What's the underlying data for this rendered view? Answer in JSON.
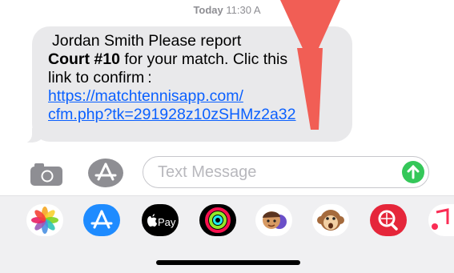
{
  "header": {
    "day": "Today",
    "time": "11:30 A"
  },
  "message": {
    "sender": "Jordan Smith",
    "text_1": " Please report",
    "court": "Court #10",
    "text_2": " for your match. Clic",
    "text_2b": " this",
    "text_3": "link to confirm :",
    "link_1": "https://matchtennisapp.com/",
    "link_2": "cfm.php?tk=291928z10zSHMz2a32"
  },
  "compose": {
    "placeholder": "Text Message"
  },
  "app_tray": {
    "items": [
      {
        "name": "photos",
        "icon": "photos-icon"
      },
      {
        "name": "app-store",
        "icon": "app-store-icon"
      },
      {
        "name": "apple-pay",
        "icon": "apple-pay-icon",
        "label": "Pay"
      },
      {
        "name": "activity",
        "icon": "activity-icon"
      },
      {
        "name": "memoji",
        "icon": "memoji-icon"
      },
      {
        "name": "animoji",
        "icon": "animoji-icon"
      },
      {
        "name": "web-search",
        "icon": "web-search-icon"
      },
      {
        "name": "music",
        "icon": "music-icon"
      }
    ]
  },
  "colors": {
    "bubble": "#e9e9eb",
    "link": "#0a60ff",
    "send": "#34c759",
    "pointer": "#f15e55"
  }
}
